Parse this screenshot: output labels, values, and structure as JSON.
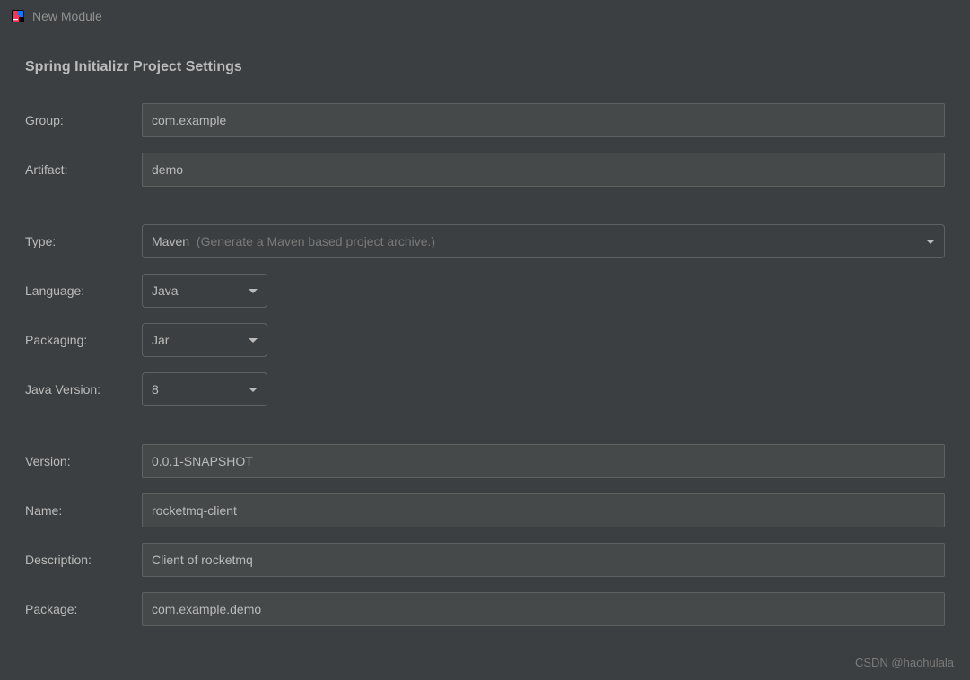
{
  "titlebar": {
    "title": "New Module"
  },
  "section_title": "Spring Initializr Project Settings",
  "labels": {
    "group": "Group:",
    "artifact": "Artifact:",
    "type": "Type:",
    "language": "Language:",
    "packaging": "Packaging:",
    "java_version": "Java Version:",
    "version": "Version:",
    "name": "Name:",
    "description": "Description:",
    "package": "Package:"
  },
  "values": {
    "group": "com.example",
    "artifact": "demo",
    "type": "Maven",
    "type_hint": "(Generate a Maven based project archive.)",
    "language": "Java",
    "packaging": "Jar",
    "java_version": "8",
    "version": "0.0.1-SNAPSHOT",
    "name": "rocketmq-client",
    "description": "Client of rocketmq",
    "package": "com.example.demo"
  },
  "watermark": "CSDN @haohulala"
}
